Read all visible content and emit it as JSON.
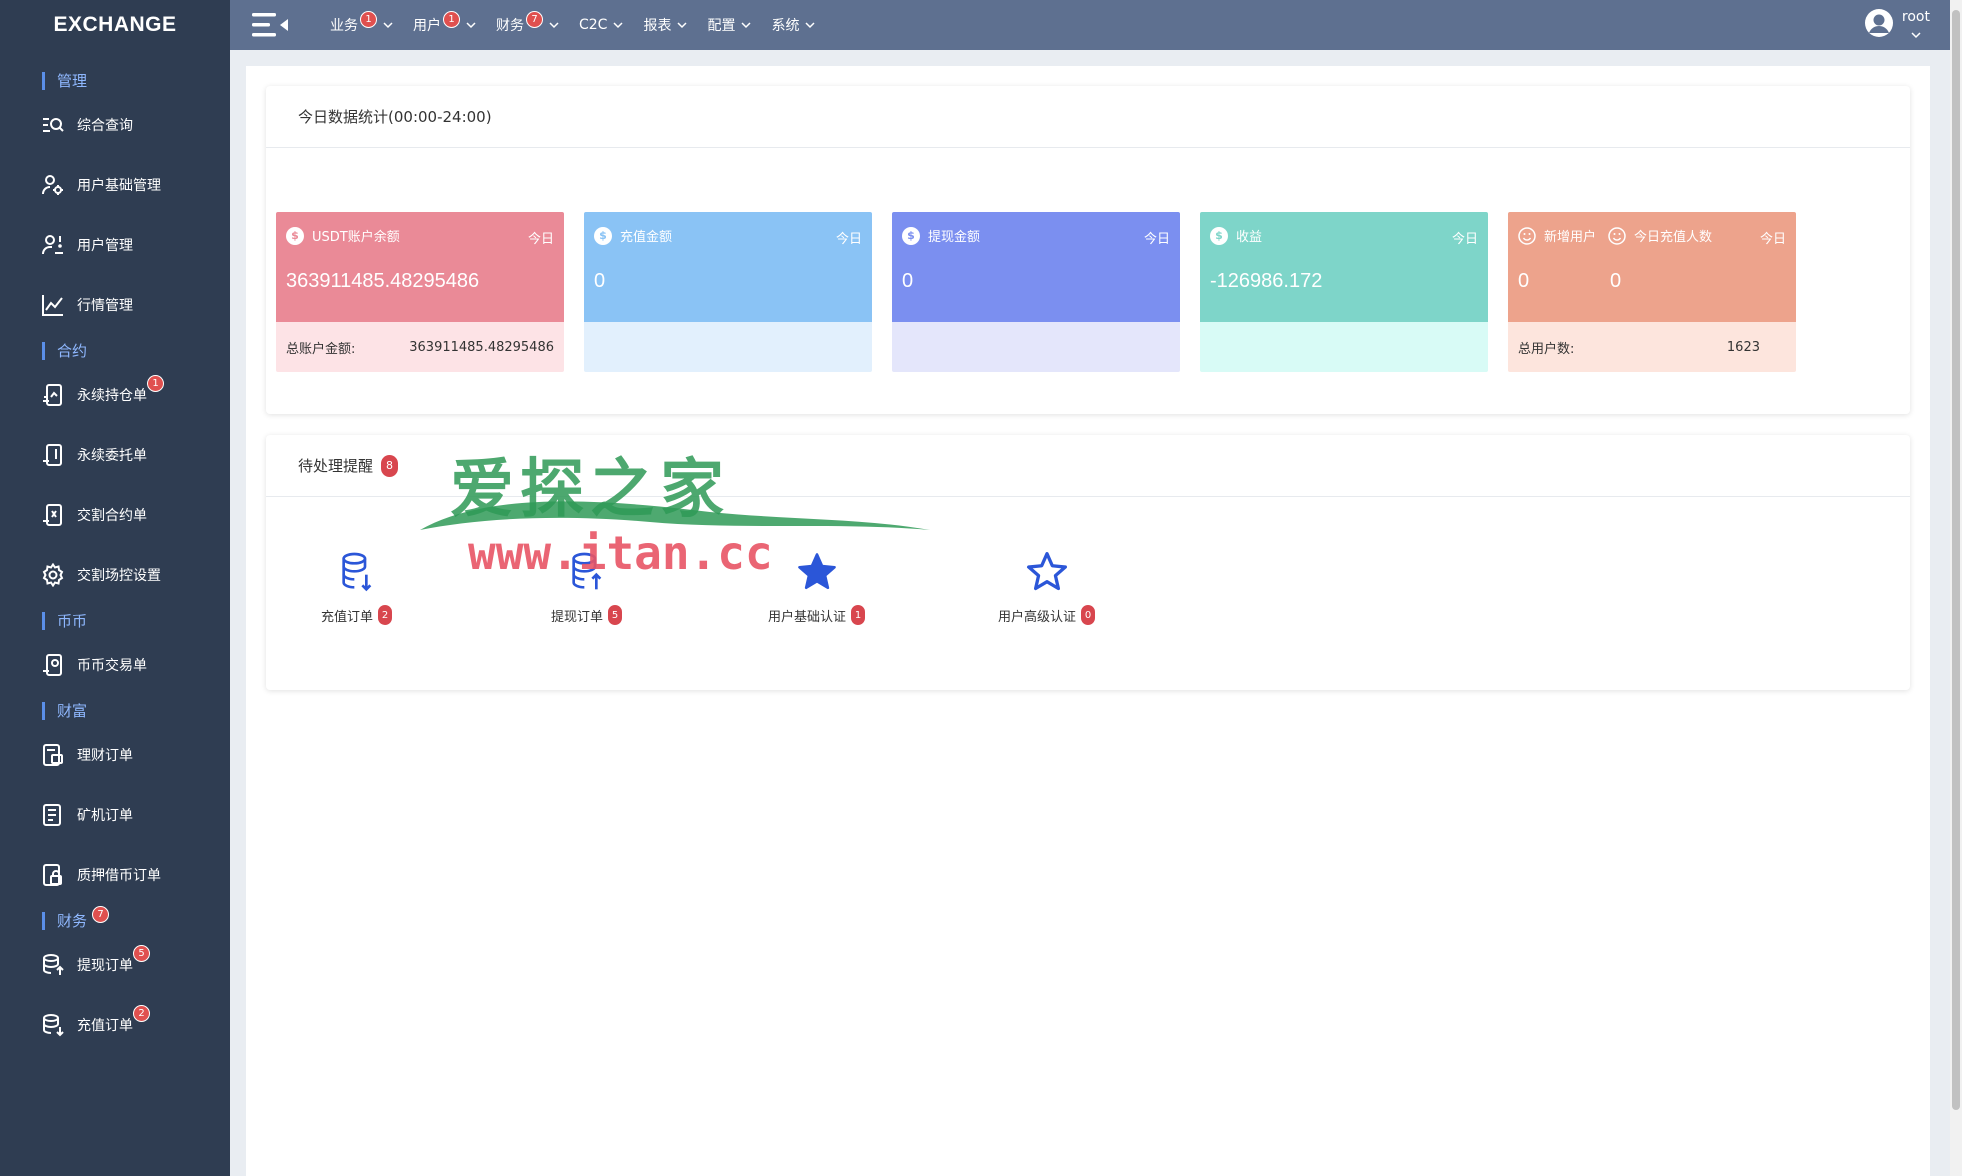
{
  "sidebar": {
    "brand": "EXCHANGE",
    "sections": {
      "manage": "管理",
      "contract": "合约",
      "coin": "币币",
      "wealth": "财富",
      "finance": "财务",
      "finance_badge": "7"
    },
    "items": {
      "query": "综合查询",
      "user_basic": "用户基础管理",
      "user_manage": "用户管理",
      "market": "行情管理",
      "perp_position": "永续持仓单",
      "perp_position_badge": "1",
      "perp_order": "永续委托单",
      "delivery_order": "交割合约单",
      "delivery_control": "交割场控设置",
      "spot_order": "币币交易单",
      "wealth_order": "理财订单",
      "miner_order": "矿机订单",
      "loan_order": "质押借币订单",
      "withdraw_order": "提现订单",
      "withdraw_badge": "5",
      "deposit_order": "充值订单",
      "deposit_badge": "2"
    }
  },
  "topbar": {
    "menu": [
      {
        "label": "业务",
        "badge": "1"
      },
      {
        "label": "用户",
        "badge": "1"
      },
      {
        "label": "财务",
        "badge": "7"
      },
      {
        "label": "C2C",
        "badge": ""
      },
      {
        "label": "报表",
        "badge": ""
      },
      {
        "label": "配置",
        "badge": ""
      },
      {
        "label": "系统",
        "badge": ""
      }
    ],
    "user": "root"
  },
  "stats_card": {
    "title": "今日数据统计(00:00-24:00)",
    "cards": {
      "usdt": {
        "title": "USDT账户余额",
        "today": "今日",
        "value": "363911485.48295486",
        "bottom_label": "总账户金额:",
        "bottom_value": "363911485.48295486",
        "color": "#ea8a97",
        "bottom_color": "#fde3e6"
      },
      "deposit": {
        "title": "充值金额",
        "today": "今日",
        "value": "0",
        "color": "#8ac3f5",
        "bottom_color": "#e2f0fd"
      },
      "withdraw": {
        "title": "提现金额",
        "today": "今日",
        "value": "0",
        "color": "#7b8ff0",
        "bottom_color": "#e4e6fb"
      },
      "income": {
        "title": "收益",
        "today": "今日",
        "value": "-126986.172",
        "color": "#7ed5c9",
        "bottom_color": "#d8fbf6"
      },
      "users": {
        "title": "新增用户",
        "title2": "今日充值人数",
        "today": "今日",
        "value": "0",
        "value2": "0",
        "bottom_label": "总用户数:",
        "bottom_value": "1623",
        "color": "#eda38c",
        "bottom_color": "#fde5dd"
      }
    }
  },
  "todo_card": {
    "title": "待处理提醒",
    "badge": "8",
    "items": {
      "deposit": {
        "label": "充值订单",
        "badge": "2"
      },
      "withdraw": {
        "label": "提现订单",
        "badge": "5"
      },
      "basic_auth": {
        "label": "用户基础认证",
        "badge": "1"
      },
      "adv_auth": {
        "label": "用户高级认证",
        "badge": "0"
      }
    }
  },
  "watermark": {
    "top": "爱探之家",
    "bottom": "www.itan.cc"
  }
}
